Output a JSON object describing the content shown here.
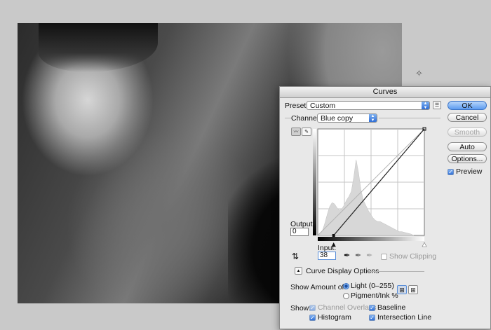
{
  "dialog": {
    "title": "Curves",
    "preset_label": "Preset:",
    "preset_value": "Custom",
    "channel_label": "Channel:",
    "channel_value": "Blue copy",
    "output_label": "Output:",
    "output_value": "0",
    "input_label": "Input:",
    "input_value": "38",
    "show_clipping_label": "Show Clipping",
    "curve_display_options_label": "Curve Display Options",
    "show_amount_label": "Show Amount of:",
    "light_label": "Light  (0–255)",
    "pigment_label": "Pigment/Ink %",
    "show_label": "Show:",
    "channel_overlays_label": "Channel Overlays",
    "baseline_label": "Baseline",
    "histogram_label": "Histogram",
    "intersection_line_label": "Intersection Line",
    "preview_label": "Preview"
  },
  "buttons": {
    "ok": "OK",
    "cancel": "Cancel",
    "smooth": "Smooth",
    "auto": "Auto",
    "options": "Options..."
  },
  "curve": {
    "points": [
      [
        38,
        0
      ],
      [
        255,
        255
      ]
    ],
    "input_range": [
      0,
      255
    ],
    "grid_divisions": 4
  },
  "states": {
    "preview": true,
    "light_selected": true,
    "pigment_selected": false,
    "show_clipping": false,
    "channel_overlays": true,
    "baseline": true,
    "histogram": true,
    "intersection_line": true
  },
  "colors": {
    "accent": "#3c73c4",
    "dialog_bg": "#e8e8e8"
  }
}
